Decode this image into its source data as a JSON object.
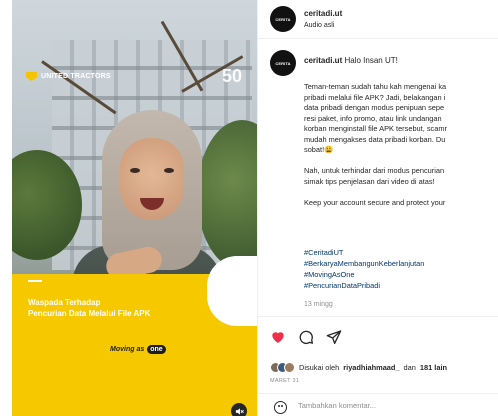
{
  "post": {
    "username": "ceritadi.ut",
    "audio": "Audio asli",
    "avatar_text": "CERITA"
  },
  "media": {
    "logo_left": "UNITED TRACTORS",
    "logo_left_sub": "ASTRA",
    "logo_right": "50",
    "headline_1": "Waspada Terhadap",
    "headline_2": "Pencurian Data  Melalui File APK",
    "moving_as": "Moving as",
    "one": "one",
    "colors": {
      "yellow": "#f6c800"
    }
  },
  "caption": {
    "username": "ceritadi.ut",
    "greeting": "Halo Insan UT!",
    "lines": [
      "Teman-teman sudah tahu kah mengenai ka",
      "pribadi melalui file APK? Jadi, belakangan i",
      "data pribadi dengan modus penipuan sepe",
      "resi paket, info promo, atau link undangan",
      "korban menginstall file APK tersebut, scamr",
      "mudah mengakses data pribadi korban. Du",
      "sobat!😩"
    ],
    "para2": [
      "Nah, untuk terhindar dari modus pencurian",
      "simak tips penjelasan dari video di atas!"
    ],
    "para3": "Keep your account secure and protect your",
    "hashtags": [
      "#CeritadiUT",
      "#BerkaryaMembangunKeberlanjutan",
      "#MovingAsOne",
      "#PencurianDataPribadi"
    ],
    "time": "13 mingg"
  },
  "actions": {
    "liked_by_prefix": "Disukai oleh",
    "liked_by_user": "riyadhiahmaad_",
    "and": "dan",
    "others": "181 lain",
    "date": "MARET 31",
    "comment_placeholder": "Tambahkan komentar..."
  },
  "icons": [
    "heart-icon",
    "comment-icon",
    "share-icon",
    "emoji-icon",
    "mute-icon"
  ]
}
